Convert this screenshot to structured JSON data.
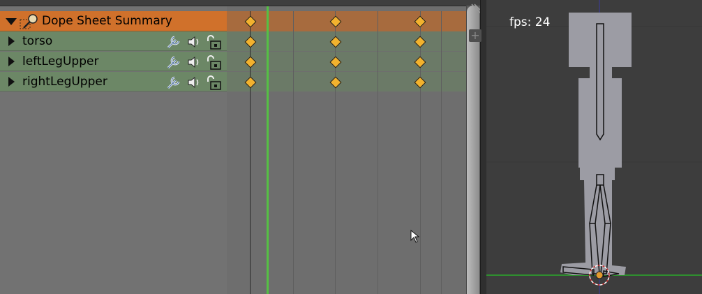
{
  "dope_sheet": {
    "summary_label": "Dope Sheet Summary",
    "channels": [
      {
        "label": "torso"
      },
      {
        "label": "leftLegUpper"
      },
      {
        "label": "rightLegUpper"
      }
    ],
    "keyframe_rows": 4,
    "keyframes_per_row": 3
  },
  "viewport": {
    "fps_text": "fps: 24"
  },
  "colors": {
    "summary": "#d0712b",
    "channel": "#6c8766",
    "keyframe": "#f2b22e",
    "playhead": "#55c044",
    "ground_line": "#2f8f2f",
    "axis_line": "#3a3aa0"
  }
}
